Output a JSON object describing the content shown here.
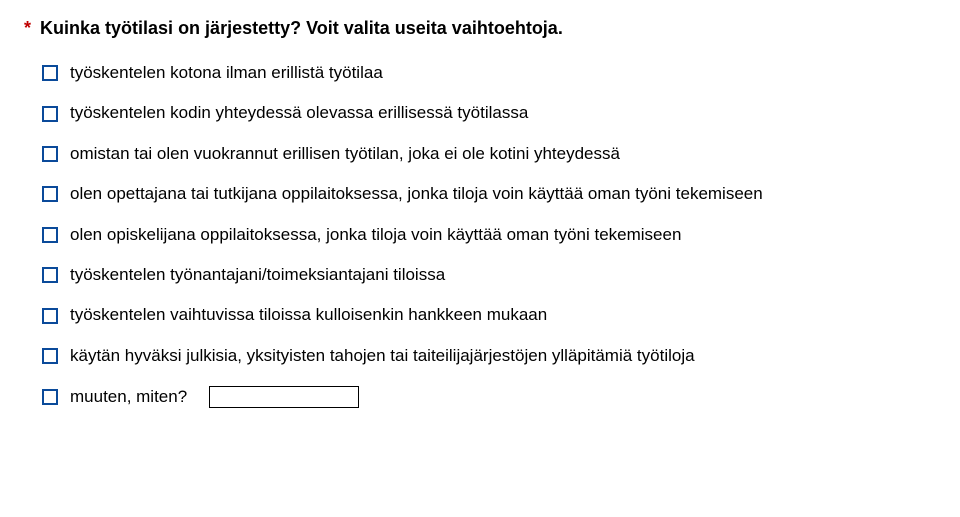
{
  "question": {
    "required_marker": "*",
    "title": "Kuinka työtilasi on järjestetty? Voit valita useita vaihtoehtoja."
  },
  "options": [
    {
      "label": "työskentelen kotona ilman erillistä työtilaa"
    },
    {
      "label": "työskentelen kodin yhteydessä olevassa erillisessä työtilassa"
    },
    {
      "label": "omistan tai olen vuokrannut erillisen työtilan, joka ei ole kotini yhteydessä"
    },
    {
      "label": "olen opettajana tai tutkijana oppilaitoksessa, jonka tiloja voin käyttää oman työni tekemiseen"
    },
    {
      "label": "olen opiskelijana oppilaitoksessa, jonka tiloja voin käyttää oman työni tekemiseen"
    },
    {
      "label": "työskentelen työnantajani/toimeksiantajani tiloissa"
    },
    {
      "label": "työskentelen vaihtuvissa tiloissa kulloisenkin hankkeen mukaan"
    },
    {
      "label": "käytän hyväksi julkisia, yksityisten tahojen tai taiteilijajärjestöjen ylläpitämiä työtiloja"
    },
    {
      "label": "muuten, miten?"
    }
  ],
  "other_input": {
    "value": ""
  }
}
